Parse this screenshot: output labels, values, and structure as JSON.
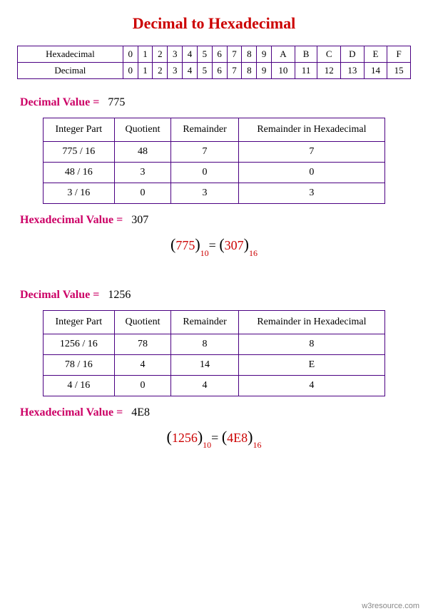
{
  "title": "Decimal to Hexadecimal",
  "map_table": {
    "row1_label": "Hexadecimal",
    "row2_label": "Decimal",
    "hex": [
      "0",
      "1",
      "2",
      "3",
      "4",
      "5",
      "6",
      "7",
      "8",
      "9",
      "A",
      "B",
      "C",
      "D",
      "E",
      "F"
    ],
    "dec": [
      "0",
      "1",
      "2",
      "3",
      "4",
      "5",
      "6",
      "7",
      "8",
      "9",
      "10",
      "11",
      "12",
      "13",
      "14",
      "15"
    ]
  },
  "labels": {
    "decimal_value": "Decimal Value  =",
    "hexadecimal_value": "Hexadecimal Value  =",
    "integer_part": "Integer Part",
    "quotient": "Quotient",
    "remainder": "Remainder",
    "remainder_hex": "Remainder  in Hexadecimal"
  },
  "ex1": {
    "decimal": "775",
    "hex": "307",
    "rows": [
      {
        "ip": "775 / 16",
        "q": "48",
        "r": "7",
        "rh": "7"
      },
      {
        "ip": "48 / 16",
        "q": "3",
        "r": "0",
        "rh": "0"
      },
      {
        "ip": "3 / 16",
        "q": "0",
        "r": "3",
        "rh": "3"
      }
    ],
    "eq": {
      "lhs": "775",
      "lsub": "10",
      "rhs": "307",
      "rsub": "16"
    }
  },
  "ex2": {
    "decimal": "1256",
    "hex": "4E8",
    "rows": [
      {
        "ip": "1256 / 16",
        "q": "78",
        "r": "8",
        "rh": "8"
      },
      {
        "ip": "78 / 16",
        "q": "4",
        "r": "14",
        "rh": "E"
      },
      {
        "ip": "4 / 16",
        "q": "0",
        "r": "4",
        "rh": "4"
      }
    ],
    "eq": {
      "lhs": "1256",
      "lsub": "10",
      "rhs": "4E8",
      "rsub": "16"
    }
  },
  "footer": "w3resource.com"
}
